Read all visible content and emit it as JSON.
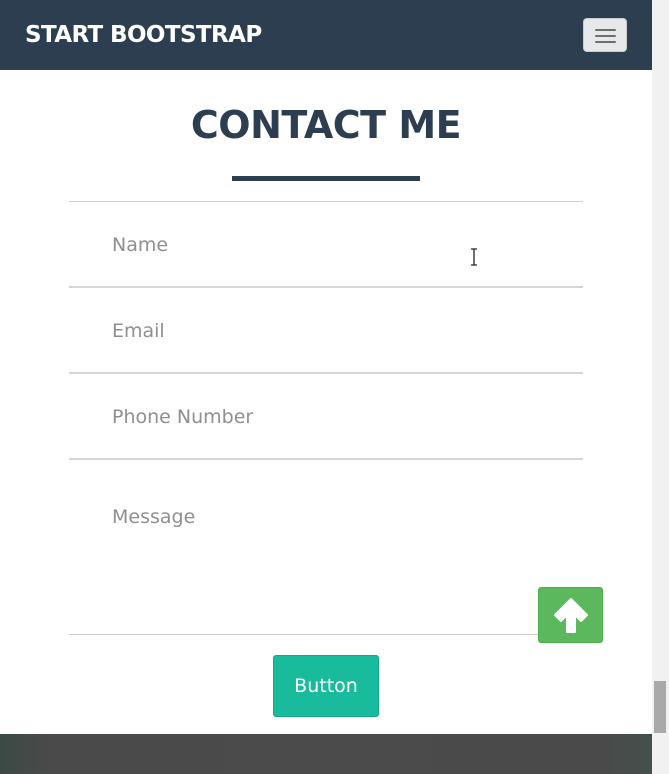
{
  "navbar": {
    "brand": "START BOOTSTRAP",
    "toggle_icon": "hamburger-menu-icon",
    "background": "#2c3e50"
  },
  "contact": {
    "title": "CONTACT ME",
    "fields": {
      "name_placeholder": "Name",
      "email_placeholder": "Email",
      "phone_placeholder": "Phone Number",
      "message_placeholder": "Message"
    },
    "submit_label": "Button"
  },
  "scroll_top_button": {
    "icon": "arrow-up-icon",
    "color": "#5cb85c"
  },
  "colors": {
    "primary_dark": "#2c3e50",
    "accent_teal": "#18bc9c",
    "success_green": "#5cb85c"
  }
}
